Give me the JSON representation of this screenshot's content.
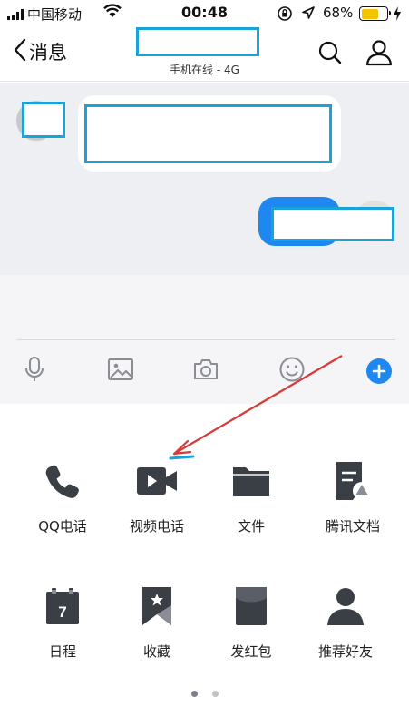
{
  "status_bar": {
    "carrier": "中国移动",
    "time": "00:48",
    "battery": "68%",
    "battery_level": 0.68,
    "icons": [
      "signal-icon",
      "wifi-icon",
      "orientation-lock-icon",
      "location-icon",
      "battery-icon",
      "charging-icon"
    ]
  },
  "nav": {
    "back_label": "消息",
    "subtitle": "手机在线 - 4G",
    "icons": [
      "back-chevron-icon",
      "search-icon",
      "profile-icon"
    ]
  },
  "chat": {
    "messages": [
      {
        "side": "left",
        "content": "redacted"
      },
      {
        "side": "right",
        "content": "redacted"
      }
    ]
  },
  "toolbar": {
    "icons": [
      "microphone-icon",
      "image-icon",
      "camera-icon",
      "emoji-icon",
      "plus-icon"
    ]
  },
  "panel": {
    "items": [
      {
        "label": "QQ电话",
        "icon": "phone-icon"
      },
      {
        "label": "视频电话",
        "icon": "video-call-icon"
      },
      {
        "label": "文件",
        "icon": "folder-icon"
      },
      {
        "label": "腾讯文档",
        "icon": "tencent-doc-icon"
      },
      {
        "label": "日程",
        "icon": "calendar-icon"
      },
      {
        "label": "收藏",
        "icon": "bookmark-icon"
      },
      {
        "label": "发红包",
        "icon": "red-packet-icon"
      },
      {
        "label": "推荐好友",
        "icon": "person-icon"
      }
    ],
    "page_count": 2,
    "current_page": 1
  },
  "colors": {
    "accent": "#1e88f0",
    "icon_dark": "#3a3e45",
    "chat_bg": "#eeeff3",
    "annotation_arrow": "#d63a3a"
  }
}
